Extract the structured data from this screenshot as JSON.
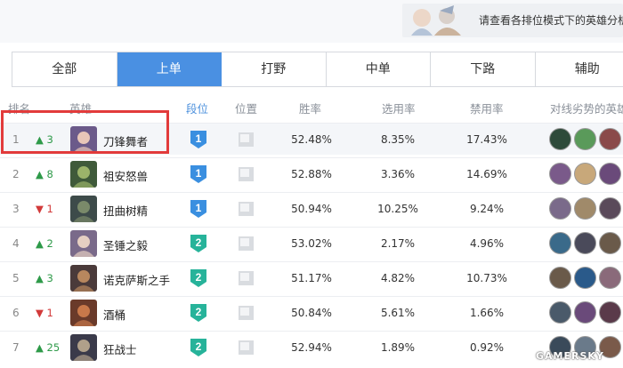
{
  "banner": {
    "text": "请查看各排位模式下的英雄分析",
    "image_icon": "hero-portrait-art"
  },
  "tabs": [
    {
      "label": "全部",
      "active": false
    },
    {
      "label": "上单",
      "active": true
    },
    {
      "label": "打野",
      "active": false
    },
    {
      "label": "中单",
      "active": false
    },
    {
      "label": "下路",
      "active": false
    },
    {
      "label": "辅助",
      "active": false
    }
  ],
  "table": {
    "headers": {
      "rank": "排名",
      "hero": "英雄",
      "tier": "段位",
      "position": "位置",
      "win_rate": "胜率",
      "pick_rate": "选用率",
      "ban_rate": "禁用率",
      "counters": "对线劣势的英雄"
    },
    "rows": [
      {
        "rank": "1",
        "change": "3",
        "dir": "up",
        "hero": "刀锋舞者",
        "tier": "1",
        "win": "52.48%",
        "pick": "8.35%",
        "ban": "17.43%"
      },
      {
        "rank": "2",
        "change": "8",
        "dir": "up",
        "hero": "祖安怒兽",
        "tier": "1",
        "win": "52.88%",
        "pick": "3.36%",
        "ban": "14.69%"
      },
      {
        "rank": "3",
        "change": "1",
        "dir": "down",
        "hero": "扭曲树精",
        "tier": "1",
        "win": "50.94%",
        "pick": "10.25%",
        "ban": "9.24%"
      },
      {
        "rank": "4",
        "change": "2",
        "dir": "up",
        "hero": "圣锤之毅",
        "tier": "2",
        "win": "53.02%",
        "pick": "2.17%",
        "ban": "4.96%"
      },
      {
        "rank": "5",
        "change": "3",
        "dir": "up",
        "hero": "诺克萨斯之手",
        "tier": "2",
        "win": "51.17%",
        "pick": "4.82%",
        "ban": "10.73%"
      },
      {
        "rank": "6",
        "change": "1",
        "dir": "down",
        "hero": "酒桶",
        "tier": "2",
        "win": "50.84%",
        "pick": "5.61%",
        "ban": "1.66%"
      },
      {
        "rank": "7",
        "change": "25",
        "dir": "up",
        "hero": "狂战士",
        "tier": "2",
        "win": "52.94%",
        "pick": "1.89%",
        "ban": "0.92%"
      }
    ]
  },
  "icons": {
    "up": "▲",
    "down": "▼",
    "tier": "tier-shield-icon",
    "position": "position-icon"
  },
  "colors": {
    "accent": "#4a90e2",
    "tier1": "#3a8fe0",
    "tier2": "#27b39a",
    "up": "#2e9a49",
    "down": "#d23a3a",
    "highlight": "#e23b3b"
  },
  "watermark": "GAMERSKY"
}
